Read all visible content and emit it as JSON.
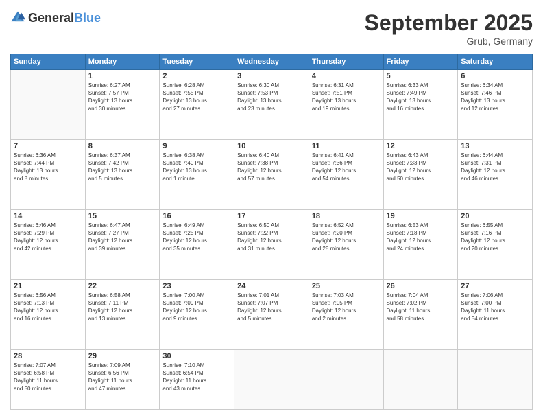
{
  "logo": {
    "general": "General",
    "blue": "Blue"
  },
  "title": "September 2025",
  "location": "Grub, Germany",
  "days_header": [
    "Sunday",
    "Monday",
    "Tuesday",
    "Wednesday",
    "Thursday",
    "Friday",
    "Saturday"
  ],
  "weeks": [
    [
      {
        "day": "",
        "info": ""
      },
      {
        "day": "1",
        "info": "Sunrise: 6:27 AM\nSunset: 7:57 PM\nDaylight: 13 hours\nand 30 minutes."
      },
      {
        "day": "2",
        "info": "Sunrise: 6:28 AM\nSunset: 7:55 PM\nDaylight: 13 hours\nand 27 minutes."
      },
      {
        "day": "3",
        "info": "Sunrise: 6:30 AM\nSunset: 7:53 PM\nDaylight: 13 hours\nand 23 minutes."
      },
      {
        "day": "4",
        "info": "Sunrise: 6:31 AM\nSunset: 7:51 PM\nDaylight: 13 hours\nand 19 minutes."
      },
      {
        "day": "5",
        "info": "Sunrise: 6:33 AM\nSunset: 7:49 PM\nDaylight: 13 hours\nand 16 minutes."
      },
      {
        "day": "6",
        "info": "Sunrise: 6:34 AM\nSunset: 7:46 PM\nDaylight: 13 hours\nand 12 minutes."
      }
    ],
    [
      {
        "day": "7",
        "info": "Sunrise: 6:36 AM\nSunset: 7:44 PM\nDaylight: 13 hours\nand 8 minutes."
      },
      {
        "day": "8",
        "info": "Sunrise: 6:37 AM\nSunset: 7:42 PM\nDaylight: 13 hours\nand 5 minutes."
      },
      {
        "day": "9",
        "info": "Sunrise: 6:38 AM\nSunset: 7:40 PM\nDaylight: 13 hours\nand 1 minute."
      },
      {
        "day": "10",
        "info": "Sunrise: 6:40 AM\nSunset: 7:38 PM\nDaylight: 12 hours\nand 57 minutes."
      },
      {
        "day": "11",
        "info": "Sunrise: 6:41 AM\nSunset: 7:36 PM\nDaylight: 12 hours\nand 54 minutes."
      },
      {
        "day": "12",
        "info": "Sunrise: 6:43 AM\nSunset: 7:33 PM\nDaylight: 12 hours\nand 50 minutes."
      },
      {
        "day": "13",
        "info": "Sunrise: 6:44 AM\nSunset: 7:31 PM\nDaylight: 12 hours\nand 46 minutes."
      }
    ],
    [
      {
        "day": "14",
        "info": "Sunrise: 6:46 AM\nSunset: 7:29 PM\nDaylight: 12 hours\nand 42 minutes."
      },
      {
        "day": "15",
        "info": "Sunrise: 6:47 AM\nSunset: 7:27 PM\nDaylight: 12 hours\nand 39 minutes."
      },
      {
        "day": "16",
        "info": "Sunrise: 6:49 AM\nSunset: 7:25 PM\nDaylight: 12 hours\nand 35 minutes."
      },
      {
        "day": "17",
        "info": "Sunrise: 6:50 AM\nSunset: 7:22 PM\nDaylight: 12 hours\nand 31 minutes."
      },
      {
        "day": "18",
        "info": "Sunrise: 6:52 AM\nSunset: 7:20 PM\nDaylight: 12 hours\nand 28 minutes."
      },
      {
        "day": "19",
        "info": "Sunrise: 6:53 AM\nSunset: 7:18 PM\nDaylight: 12 hours\nand 24 minutes."
      },
      {
        "day": "20",
        "info": "Sunrise: 6:55 AM\nSunset: 7:16 PM\nDaylight: 12 hours\nand 20 minutes."
      }
    ],
    [
      {
        "day": "21",
        "info": "Sunrise: 6:56 AM\nSunset: 7:13 PM\nDaylight: 12 hours\nand 16 minutes."
      },
      {
        "day": "22",
        "info": "Sunrise: 6:58 AM\nSunset: 7:11 PM\nDaylight: 12 hours\nand 13 minutes."
      },
      {
        "day": "23",
        "info": "Sunrise: 7:00 AM\nSunset: 7:09 PM\nDaylight: 12 hours\nand 9 minutes."
      },
      {
        "day": "24",
        "info": "Sunrise: 7:01 AM\nSunset: 7:07 PM\nDaylight: 12 hours\nand 5 minutes."
      },
      {
        "day": "25",
        "info": "Sunrise: 7:03 AM\nSunset: 7:05 PM\nDaylight: 12 hours\nand 2 minutes."
      },
      {
        "day": "26",
        "info": "Sunrise: 7:04 AM\nSunset: 7:02 PM\nDaylight: 11 hours\nand 58 minutes."
      },
      {
        "day": "27",
        "info": "Sunrise: 7:06 AM\nSunset: 7:00 PM\nDaylight: 11 hours\nand 54 minutes."
      }
    ],
    [
      {
        "day": "28",
        "info": "Sunrise: 7:07 AM\nSunset: 6:58 PM\nDaylight: 11 hours\nand 50 minutes."
      },
      {
        "day": "29",
        "info": "Sunrise: 7:09 AM\nSunset: 6:56 PM\nDaylight: 11 hours\nand 47 minutes."
      },
      {
        "day": "30",
        "info": "Sunrise: 7:10 AM\nSunset: 6:54 PM\nDaylight: 11 hours\nand 43 minutes."
      },
      {
        "day": "",
        "info": ""
      },
      {
        "day": "",
        "info": ""
      },
      {
        "day": "",
        "info": ""
      },
      {
        "day": "",
        "info": ""
      }
    ]
  ]
}
